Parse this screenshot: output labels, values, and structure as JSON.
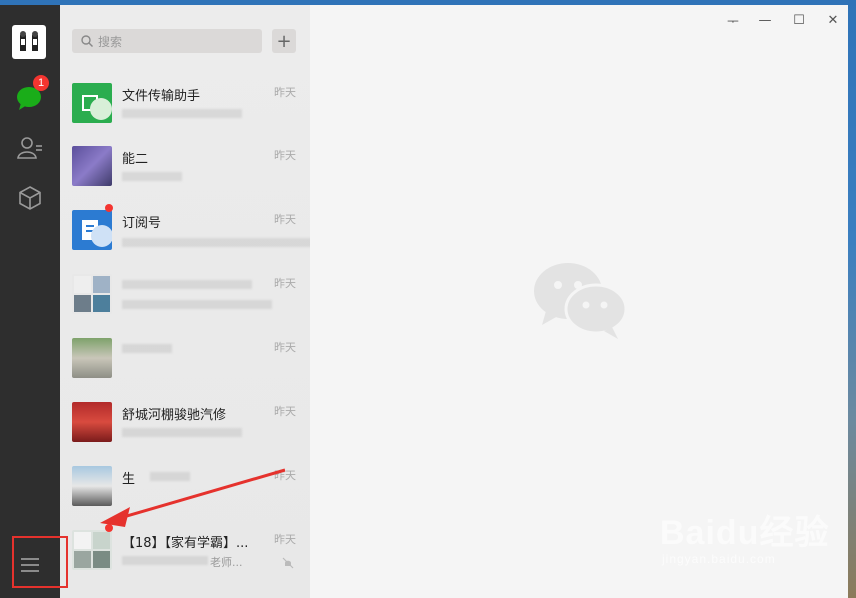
{
  "sidebar": {
    "chat_badge": "1"
  },
  "search": {
    "placeholder": "搜索"
  },
  "chats": [
    {
      "name": "文件传输助手",
      "time": "昨天",
      "preview": ""
    },
    {
      "name": "能二",
      "time": "昨天",
      "preview": ""
    },
    {
      "name": "订阅号",
      "time": "昨天",
      "preview": ""
    },
    {
      "name": "",
      "time": "昨天",
      "preview": ""
    },
    {
      "name": "",
      "time": "昨天",
      "preview": ""
    },
    {
      "name": "舒城河棚骏驰汽修",
      "time": "昨天",
      "preview": ""
    },
    {
      "name": "生",
      "time": "昨天",
      "preview": ""
    },
    {
      "name": "【18】【家有学霸】...",
      "time": "昨天",
      "preview": "老师..."
    }
  ],
  "window_controls": {
    "pin": "ᅮ",
    "minimize": "—",
    "maximize": "☐",
    "close": "✕"
  },
  "watermark": {
    "brand": "Baidu经验",
    "url": "jingyan.baidu.com"
  },
  "colors": {
    "sidebar": "#2e2e2e",
    "accent_green": "#1aad19",
    "badge_red": "#f43530",
    "annotation_red": "#e5322d"
  }
}
